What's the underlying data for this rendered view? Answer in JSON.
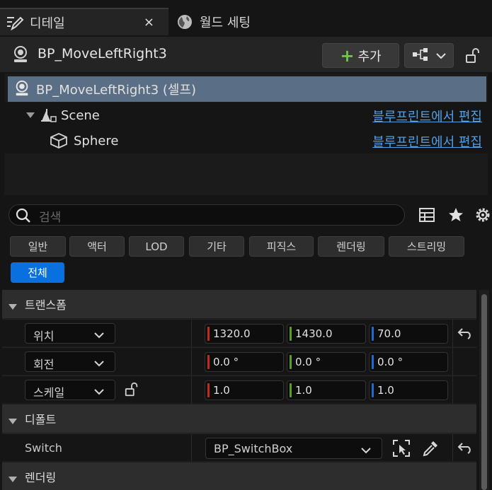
{
  "tabs": [
    {
      "label": "디테일",
      "icon": "details-pencil-icon",
      "active": true,
      "close": "×"
    },
    {
      "label": "월드 세팅",
      "icon": "world-globe-icon",
      "active": false
    }
  ],
  "header": {
    "actor_name": "BP_MoveLeftRight3",
    "add_label": "추가",
    "add_color": "#6ec74a"
  },
  "tree": {
    "self_label": "BP_MoveLeftRight3 (셀프)",
    "items": [
      {
        "label": "Scene",
        "link": "블루프린트에서 편집"
      },
      {
        "label": "Sphere",
        "link": "블루프린트에서 편집"
      }
    ]
  },
  "search": {
    "placeholder": "검색"
  },
  "filters": {
    "row1": [
      "일반",
      "액터",
      "LOD",
      "기타",
      "피직스",
      "렌더링",
      "스트리밍"
    ],
    "row2": [
      "전체"
    ],
    "selected": "전체",
    "selected_color": "#0a70e0"
  },
  "transform": {
    "category": "트랜스폼",
    "rows": [
      {
        "mode": "위치",
        "x": "1320.0",
        "y": "1430.0",
        "z": "70.0"
      },
      {
        "mode": "회전",
        "x": "0.0 °",
        "y": "0.0 °",
        "z": "0.0 °"
      },
      {
        "mode": "스케일",
        "x": "1.0",
        "y": "1.0",
        "z": "1.0"
      }
    ],
    "axis_colors": {
      "x": "#c8281e",
      "y": "#5f9e1c",
      "z": "#1e6ad0"
    }
  },
  "default": {
    "category": "디폴트",
    "switch_label": "Switch",
    "switch_value": "BP_SwitchBox"
  },
  "rendering": {
    "category": "렌더링"
  }
}
